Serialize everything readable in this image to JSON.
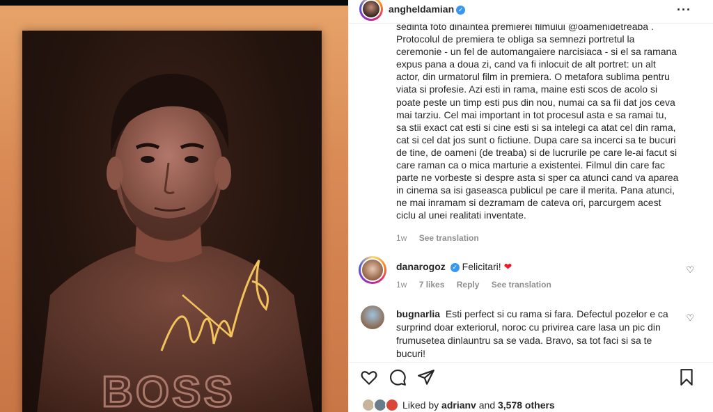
{
  "post": {
    "author": "angheldamian",
    "caption_lines": [
      "sedinta foto dinaintea premierei filmului @oamenidetreaba .",
      "Protocolul de premiera te obliga sa semnezi portretul la",
      "ceremonie - un fel de automangaiere narcisiaca - si el sa ramana",
      "expus pana a doua zi, cand va fi inlocuit de alt portret: un alt",
      "actor, din urmatorul film in premiera. O metafora sublima pentru",
      "viata si profesie. Azi esti in rama, maine esti scos de acolo si",
      "poate peste un timp esti pus din nou, numai ca sa fii dat jos ceva",
      "mai tarziu. Cel mai important in tot procesul asta e sa ramai tu,",
      "sa stii exact cat esti si cine esti si sa intelegi ca atat cel din rama,",
      "cat si cel dat jos sunt o fictiune. Dupa care sa incerci sa te bucuri",
      "de tine, de oameni (de treaba) si de lucrurile pe care le-ai facut si",
      "care raman ca o mica marturie a existentei. Filmul din care fac",
      "parte ne vorbeste si despre asta si sper ca atunci cand va aparea",
      "in cinema sa isi gaseasca publicul pe care il merita. Pana atunci,",
      "ne mai inramam si dezramam de cateva ori, parcurgem acest",
      "ciclu al unei realitati inventate."
    ],
    "time": "1w",
    "see_translation": "See translation"
  },
  "comments": [
    {
      "user": "danarogoz",
      "verified": true,
      "text": "Felicitari!",
      "emoji": "❤",
      "time": "1w",
      "likes": "7 likes",
      "reply": "Reply",
      "see_translation": "See translation"
    },
    {
      "user": "bugnarlia",
      "verified": false,
      "text_lines": [
        "Esti perfect si cu rama si fara. Defectul pozelor e ca",
        "surprind doar exteriorul, noroc cu privirea care lasa un pic din",
        "frumusetea dinlauntru sa se vada. Bravo, sa tot faci si sa te",
        "bucuri!"
      ]
    }
  ],
  "actions": {
    "liked_by_prefix": "Liked by",
    "liked_by_user": "adrianv",
    "liked_by_and": "and",
    "liked_by_count": "3,578 others"
  },
  "photo": {
    "brand_text": "BOSS"
  },
  "icons": {
    "more": "more-options-icon",
    "like": "heart-icon",
    "comment": "comment-icon",
    "share": "share-icon",
    "save": "bookmark-icon"
  },
  "colors": {
    "accent": "#3897f0",
    "heart": "#ed1c24",
    "muted": "#8e8e8e",
    "photo_bg": "#d98a55"
  }
}
